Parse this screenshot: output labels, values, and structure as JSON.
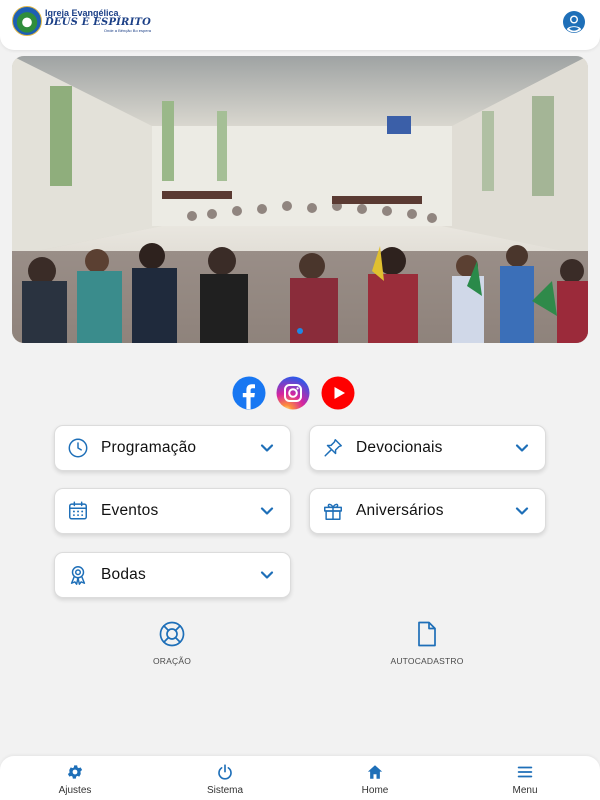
{
  "header": {
    "logo_line1": "Igreja Evangélica",
    "logo_line2": "DEUS É ESPÍRITO",
    "logo_line3": "Onde a Bênção Bo espera",
    "profile_icon": "user-circle-icon"
  },
  "hero": {
    "slide_count": 1,
    "active_slide": 1
  },
  "social": [
    {
      "name": "facebook",
      "icon": "facebook-icon",
      "color": "#1877f2"
    },
    {
      "name": "instagram",
      "icon": "instagram-icon",
      "color": "#d6249f"
    },
    {
      "name": "youtube",
      "icon": "youtube-icon",
      "color": "#ff0000"
    }
  ],
  "cards": [
    {
      "label": "Programação",
      "icon": "clock-icon"
    },
    {
      "label": "Devocionais",
      "icon": "pin-icon"
    },
    {
      "label": "Eventos",
      "icon": "calendar-icon"
    },
    {
      "label": "Aniversários",
      "icon": "gift-icon"
    },
    {
      "label": "Bodas",
      "icon": "award-icon"
    }
  ],
  "tiles": [
    {
      "label": "ORAÇÃO",
      "icon": "lifebuoy-icon"
    },
    {
      "label": "AUTOCADASTRO",
      "icon": "document-icon"
    }
  ],
  "bottom_nav": [
    {
      "label": "Ajustes",
      "icon": "gear-icon"
    },
    {
      "label": "Sistema",
      "icon": "power-icon"
    },
    {
      "label": "Home",
      "icon": "home-icon"
    },
    {
      "label": "Menu",
      "icon": "menu-icon"
    }
  ],
  "colors": {
    "accent": "#1e6fb8",
    "background": "#f2f2f2",
    "card_border": "#dcdcdc"
  }
}
